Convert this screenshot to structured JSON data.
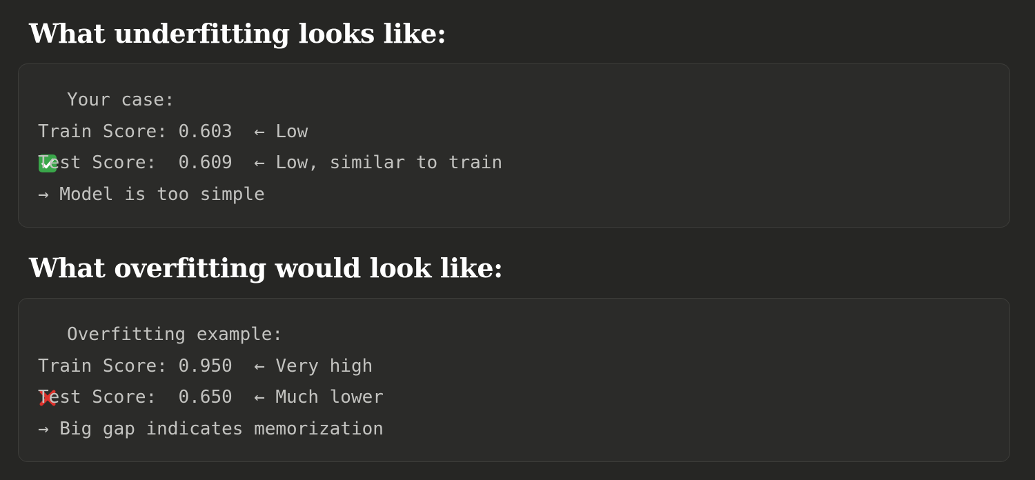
{
  "sections": [
    {
      "heading": "What underfitting looks like:",
      "block": {
        "first_line_icon": "check-mark-icon",
        "lines": [
          "Your case:",
          "Train Score: 0.603  ← Low",
          "Test Score:  0.609  ← Low, similar to train",
          "→ Model is too simple"
        ]
      }
    },
    {
      "heading": "What overfitting would look like:",
      "block": {
        "first_line_icon": "cross-mark-icon",
        "lines": [
          "Overfitting example:",
          "Train Score: 0.950  ← Very high",
          "Test Score:  0.650  ← Much lower",
          "→ Big gap indicates memorization"
        ]
      }
    }
  ],
  "colors": {
    "background": "#262624",
    "block_background": "#2b2b29",
    "heading_text": "#ffffff",
    "code_text": "#c3c3c0",
    "check_green": "#3aa64a",
    "cross_red": "#e0312b"
  }
}
